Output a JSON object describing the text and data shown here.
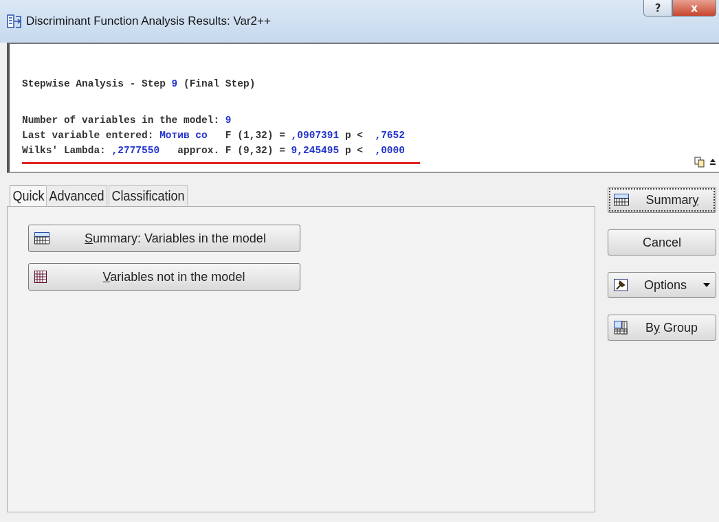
{
  "window": {
    "title": "Discriminant Function Analysis Results: Var2++",
    "buttons": [
      {
        "kind": "help",
        "label": "?"
      },
      {
        "kind": "close",
        "label": "x"
      }
    ]
  },
  "output": {
    "heading": [
      {
        "kind": "text",
        "text": "Stepwise Analysis - Step "
      },
      {
        "kind": "value",
        "text": "9"
      },
      {
        "kind": "text",
        "text": " (Final Step)"
      }
    ],
    "lines": [
      [
        {
          "kind": "text",
          "text": "Number of variables in the model: "
        },
        {
          "kind": "value",
          "text": "9"
        }
      ],
      [
        {
          "kind": "text",
          "text": "Last variable entered: "
        },
        {
          "kind": "value",
          "text": "Мотив со"
        },
        {
          "kind": "text",
          "text": "   F (1,32) = "
        },
        {
          "kind": "value",
          "text": ",0907391"
        },
        {
          "kind": "text",
          "text": " p <  "
        },
        {
          "kind": "value",
          "text": ",7652"
        }
      ],
      [
        {
          "kind": "text",
          "text": "Wilks' Lambda: "
        },
        {
          "kind": "value",
          "text": ",2777550"
        },
        {
          "kind": "text",
          "text": "   approx. F (9,32) = "
        },
        {
          "kind": "value",
          "text": "9,245495"
        },
        {
          "kind": "text",
          "text": " p <  "
        },
        {
          "kind": "value",
          "text": ",0000"
        }
      ]
    ],
    "marked": true
  },
  "tabs": [
    {
      "label": "Quick",
      "selected": true
    },
    {
      "label": "Advanced",
      "selected": false
    },
    {
      "label": "Classification",
      "selected": false
    }
  ],
  "panel_buttons": [
    {
      "kind": "summary",
      "hotkey": "S",
      "after": "ummary:  Variables in the model"
    },
    {
      "kind": "variables",
      "hotkey": "V",
      "after": "ariables not in the model"
    }
  ],
  "side_buttons": [
    {
      "kind": "summary",
      "before": "Summar",
      "hotkey": "y",
      "focused": true
    },
    {
      "kind": "cancel",
      "before": "Cancel",
      "focused": false
    },
    {
      "kind": "options",
      "before": "Options",
      "focused": false,
      "dropdown": true
    },
    {
      "kind": "bygroup",
      "before": "B",
      "hotkey": "y",
      "after": " Group",
      "focused": false
    }
  ]
}
